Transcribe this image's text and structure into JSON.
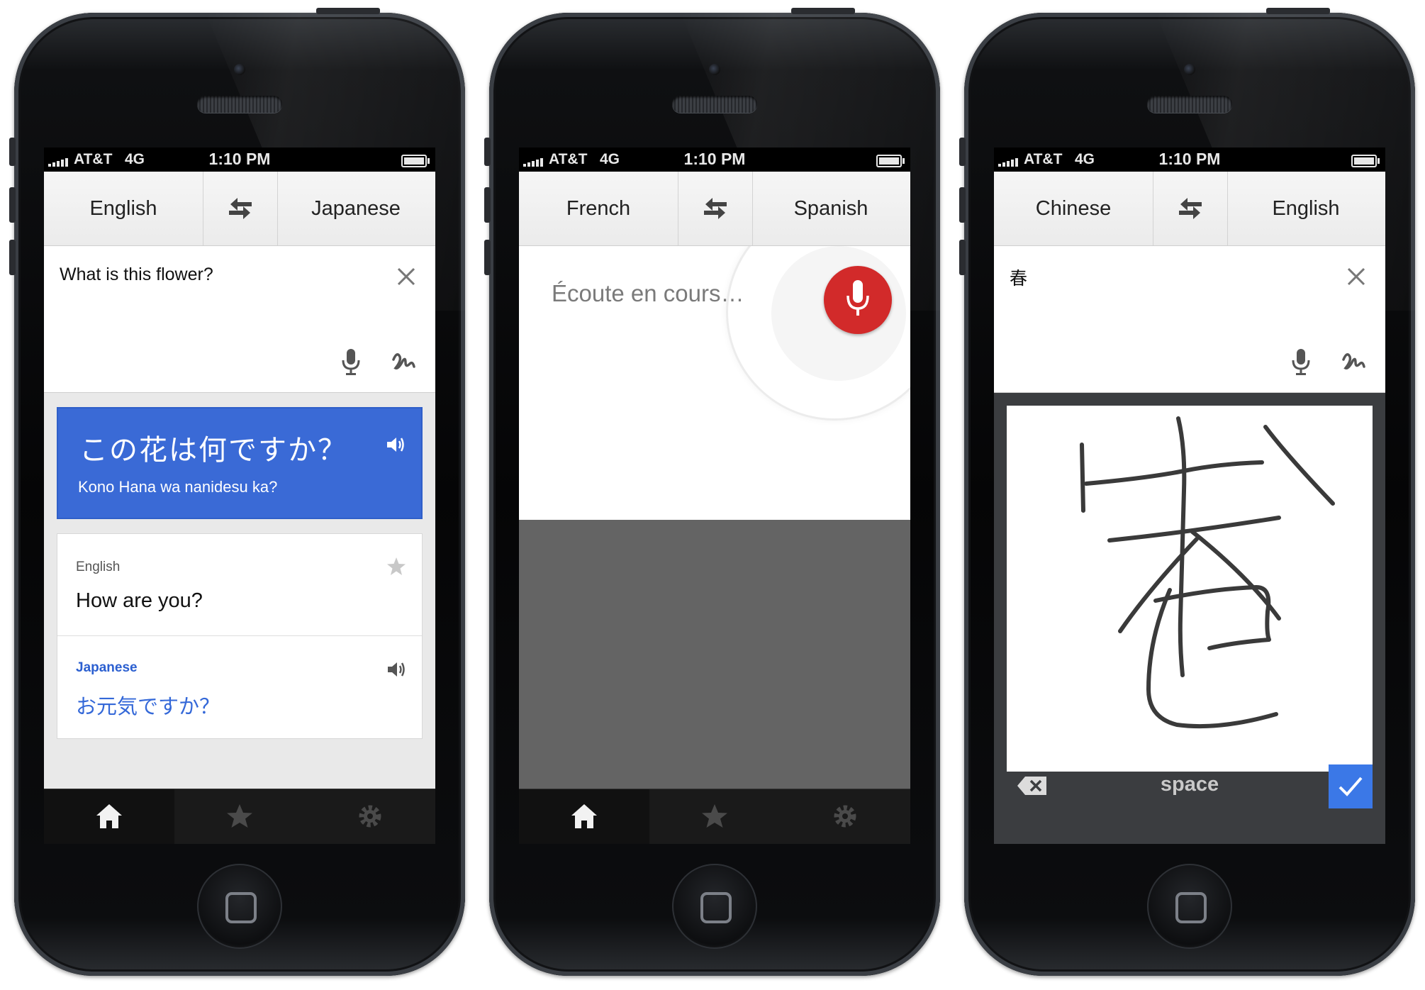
{
  "status": {
    "carrier": "AT&T",
    "network": "4G",
    "time": "1:10 PM"
  },
  "phone1": {
    "source_lang": "English",
    "target_lang": "Japanese",
    "input_text": "What is this flower?",
    "result_main": "この花は何ですか？",
    "result_romanization": "Kono Hana wa nanidesu ka?",
    "phrase_source_lang": "English",
    "phrase_source_text": "How are you?",
    "phrase_target_lang": "Japanese",
    "phrase_target_text": "お元気ですか？"
  },
  "phone2": {
    "source_lang": "French",
    "target_lang": "Spanish",
    "listening_text": "Écoute en cours…"
  },
  "phone3": {
    "source_lang": "Chinese",
    "target_lang": "English",
    "input_text": "春",
    "space_label": "space"
  },
  "colors": {
    "accent_blue": "#3a6ad6",
    "mic_red": "#d22a2a",
    "done_blue": "#3b78e7"
  },
  "icons": [
    "swap-icon",
    "close-icon",
    "microphone-icon",
    "handwriting-icon",
    "speaker-icon",
    "star-icon",
    "home-icon",
    "settings-icon",
    "backspace-icon",
    "checkmark-icon"
  ]
}
